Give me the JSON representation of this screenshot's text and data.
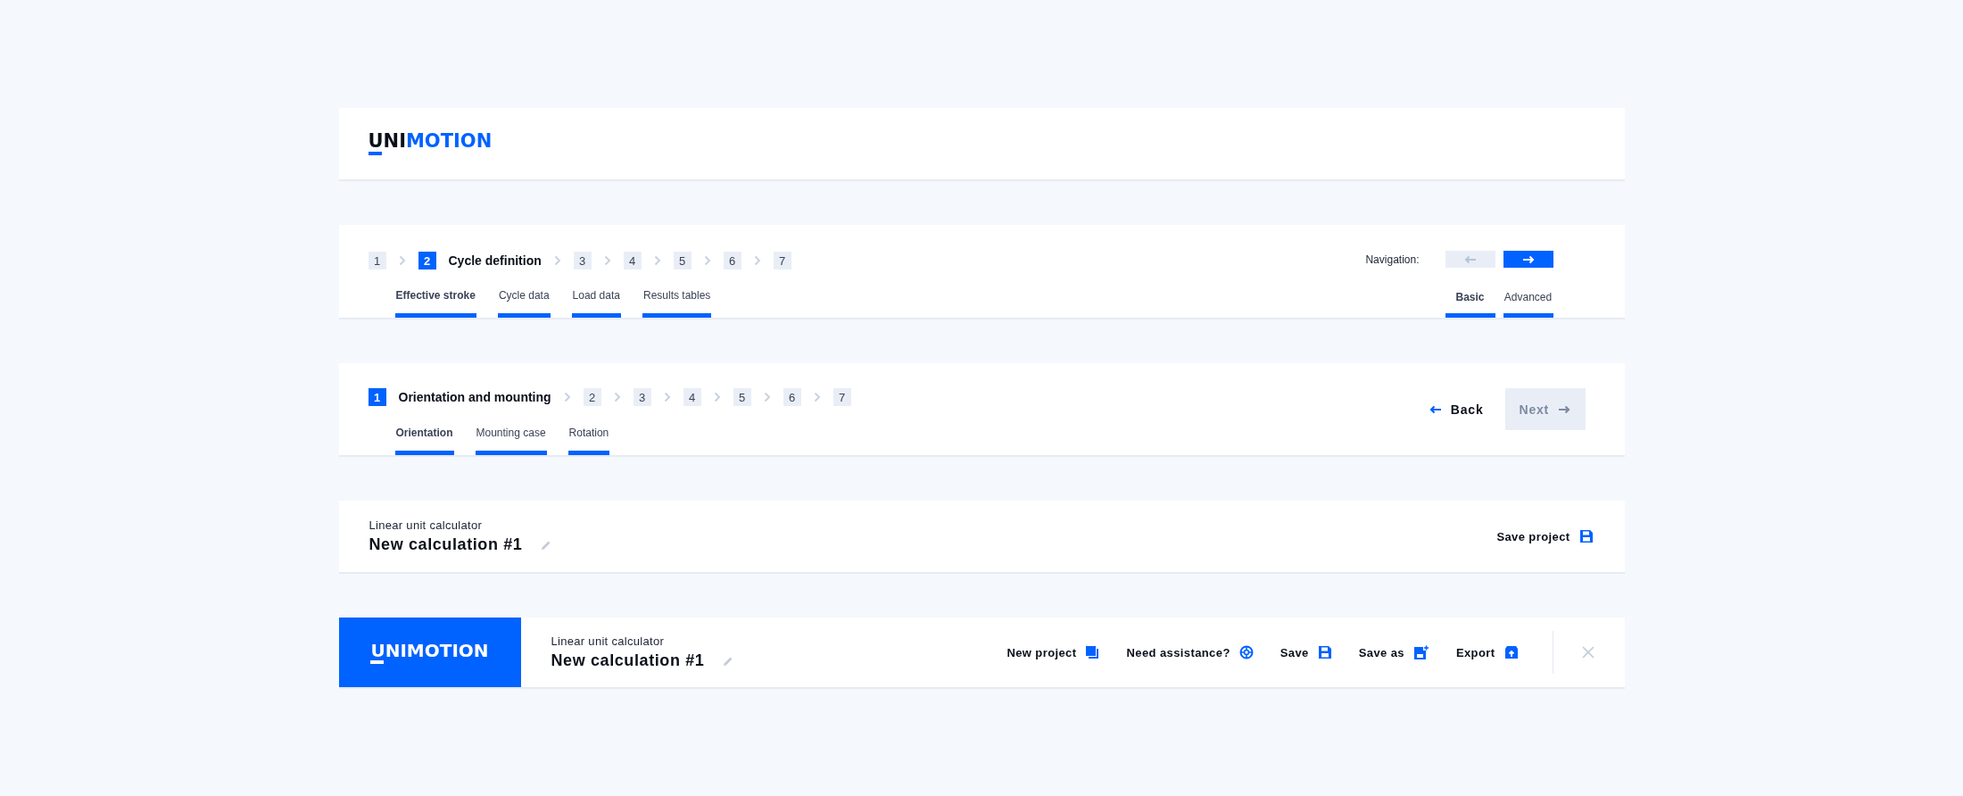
{
  "logo_header": {
    "logo": {
      "prefix": "UNI",
      "suffix": "MOTION"
    }
  },
  "cycle_panel": {
    "steps": [
      {
        "number": "1",
        "selected": false
      },
      {
        "number": "2",
        "selected": true,
        "label": "Cycle definition"
      },
      {
        "number": "3",
        "selected": false
      },
      {
        "number": "4",
        "selected": false
      },
      {
        "number": "5",
        "selected": false
      },
      {
        "number": "6",
        "selected": false
      },
      {
        "number": "7",
        "selected": false
      }
    ],
    "tabs": [
      {
        "label": "Effective stroke",
        "selected": true
      },
      {
        "label": "Cycle data",
        "selected": false
      },
      {
        "label": "Load data",
        "selected": false
      },
      {
        "label": "Results tables",
        "selected": false
      }
    ],
    "navigation": {
      "label": "Navigation:",
      "back_disabled": true,
      "forward_disabled": false
    },
    "mode_tabs": [
      {
        "label": "Basic",
        "selected": true
      },
      {
        "label": "Advanced",
        "selected": false
      }
    ]
  },
  "orientation_panel": {
    "steps": [
      {
        "number": "1",
        "selected": true,
        "label": "Orientation and mounting"
      },
      {
        "number": "2",
        "selected": false
      },
      {
        "number": "3",
        "selected": false
      },
      {
        "number": "4",
        "selected": false
      },
      {
        "number": "5",
        "selected": false
      },
      {
        "number": "6",
        "selected": false
      },
      {
        "number": "7",
        "selected": false
      }
    ],
    "tabs": [
      {
        "label": "Orientation",
        "selected": true
      },
      {
        "label": "Mounting case",
        "selected": false
      },
      {
        "label": "Rotation",
        "selected": false
      }
    ],
    "back": {
      "label": "Back",
      "disabled": false
    },
    "next": {
      "label": "Next",
      "disabled": true
    }
  },
  "project_bar": {
    "subtitle": "Linear unit calculator",
    "title": "New calculation #1",
    "save_label": "Save project"
  },
  "app_header": {
    "logo": {
      "prefix": "UNI",
      "suffix": "MOTION"
    },
    "subtitle": "Linear unit calculator",
    "title": "New calculation #1",
    "actions": [
      {
        "label": "New project",
        "kind": "new"
      },
      {
        "label": "Need assistance?",
        "kind": "help"
      },
      {
        "label": "Save",
        "kind": "save"
      },
      {
        "label": "Save as",
        "kind": "save-as"
      },
      {
        "label": "Export",
        "kind": "export"
      }
    ]
  }
}
